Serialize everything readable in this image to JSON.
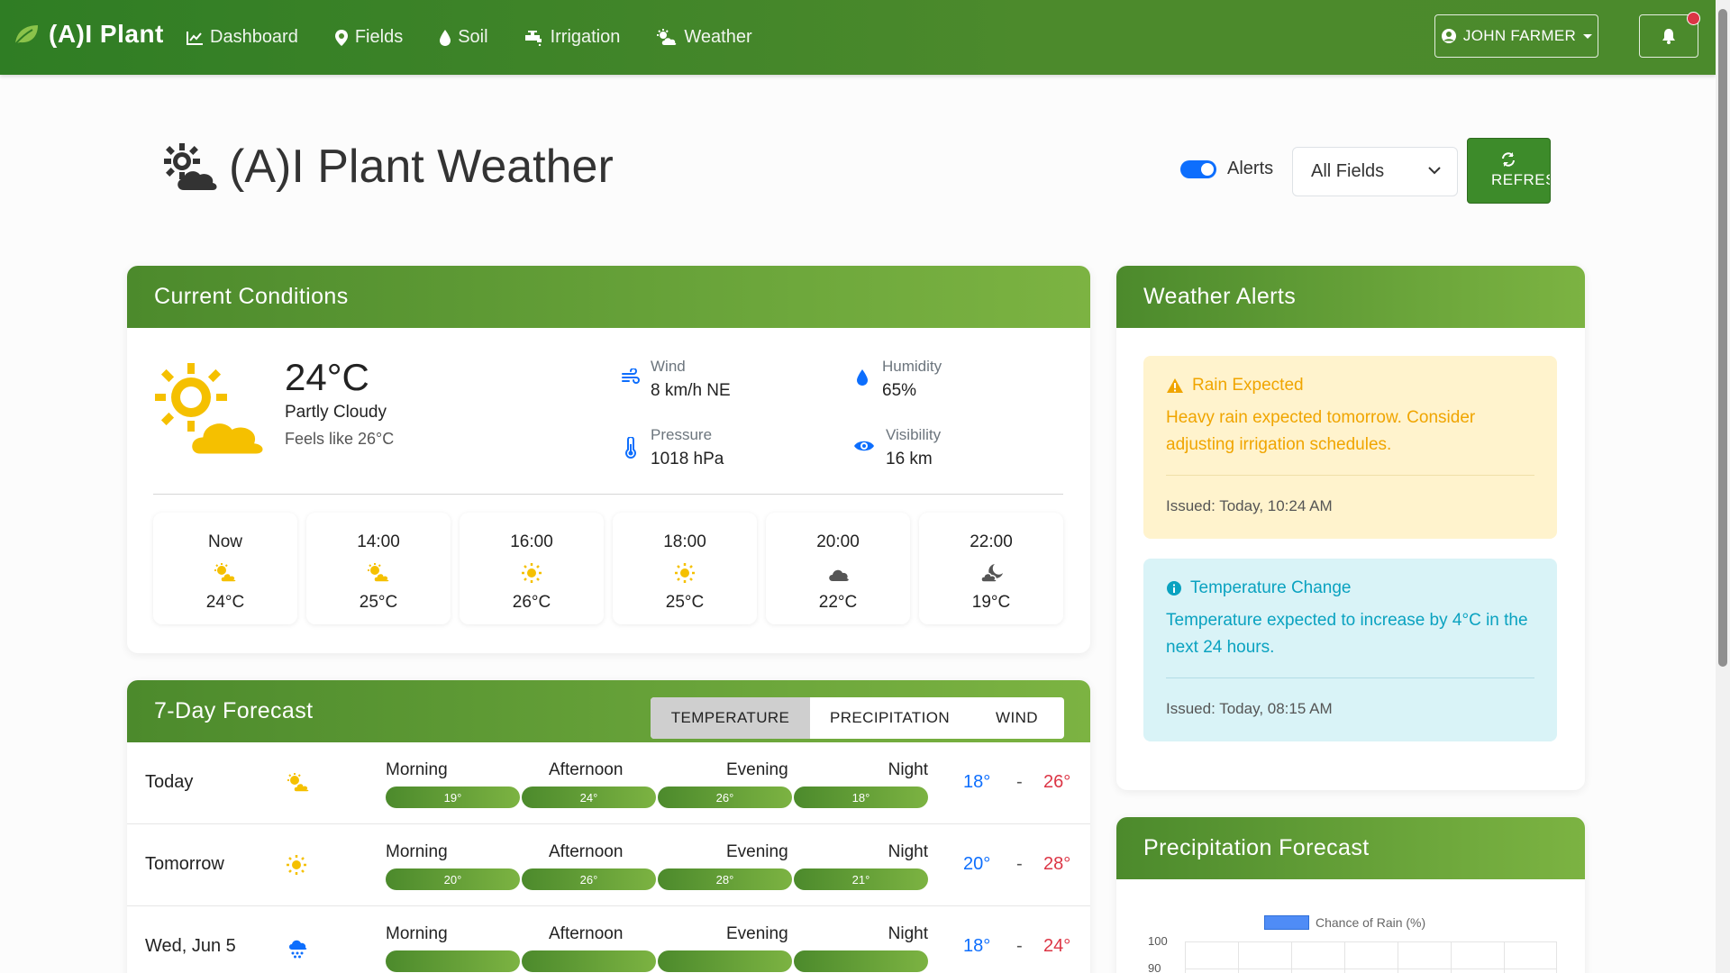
{
  "navbar": {
    "brand": "(A)I Plant",
    "links": [
      {
        "label": "Dashboard",
        "icon": "chart-line-icon"
      },
      {
        "label": "Fields",
        "icon": "map-pin-icon"
      },
      {
        "label": "Soil",
        "icon": "droplet-icon"
      },
      {
        "label": "Irrigation",
        "icon": "faucet-icon"
      },
      {
        "label": "Weather",
        "icon": "cloud-sun-icon"
      }
    ],
    "user": "JOHN FARMER"
  },
  "header": {
    "title": "(A)I Plant Weather",
    "alerts_label": "Alerts",
    "field_select": "All Fields",
    "refresh_label": "REFRESH"
  },
  "current": {
    "title": "Current Conditions",
    "temp": "24°C",
    "condition": "Partly Cloudy",
    "feels_like": "Feels like 26°C",
    "stats": {
      "wind": {
        "label": "Wind",
        "value": "8 km/h NE"
      },
      "humidity": {
        "label": "Humidity",
        "value": "65%"
      },
      "pressure": {
        "label": "Pressure",
        "value": "1018 hPa"
      },
      "visibility": {
        "label": "Visibility",
        "value": "16 km"
      }
    },
    "hourly": [
      {
        "time": "Now",
        "temp": "24°C",
        "icon": "cloud-sun-icon"
      },
      {
        "time": "14:00",
        "temp": "25°C",
        "icon": "cloud-sun-icon"
      },
      {
        "time": "16:00",
        "temp": "26°C",
        "icon": "sun-icon"
      },
      {
        "time": "18:00",
        "temp": "25°C",
        "icon": "sun-icon"
      },
      {
        "time": "20:00",
        "temp": "22°C",
        "icon": "cloud-icon"
      },
      {
        "time": "22:00",
        "temp": "19°C",
        "icon": "cloud-moon-icon"
      }
    ]
  },
  "forecast": {
    "title": "7-Day Forecast",
    "tabs": [
      "TEMPERATURE",
      "PRECIPITATION",
      "WIND"
    ],
    "part_labels": [
      "Morning",
      "Afternoon",
      "Evening",
      "Night"
    ],
    "days": [
      {
        "day": "Today",
        "icon": "cloud-sun-icon",
        "parts": [
          "19°",
          "24°",
          "26°",
          "18°"
        ],
        "low": "18°",
        "high": "26°"
      },
      {
        "day": "Tomorrow",
        "icon": "sun-icon",
        "parts": [
          "20°",
          "26°",
          "28°",
          "21°"
        ],
        "low": "20°",
        "high": "28°"
      },
      {
        "day": "Wed, Jun 5",
        "icon": "cloud-rain-icon",
        "parts": [
          "",
          "",
          "",
          ""
        ],
        "low": "18°",
        "high": "24°"
      }
    ]
  },
  "alerts": {
    "title": "Weather Alerts",
    "items": [
      {
        "title": "Rain Expected",
        "body": "Heavy rain expected tomorrow. Consider adjusting irrigation schedules.",
        "issued": "Issued: Today, 10:24 AM",
        "icon": "warning-icon"
      },
      {
        "title": "Temperature Change",
        "body": "Temperature expected to increase by 4°C in the next 24 hours.",
        "issued": "Issued: Today, 08:15 AM",
        "icon": "info-icon"
      }
    ]
  },
  "precip": {
    "title": "Precipitation Forecast",
    "legend": "Chance of Rain (%)",
    "yticks": [
      "100",
      "90"
    ]
  },
  "colors": {
    "brand_green": "#4c8a2c",
    "accent_green": "#7cb342",
    "low_blue": "#0d6efd",
    "high_red": "#dc3545",
    "sun": "#f5b800"
  }
}
